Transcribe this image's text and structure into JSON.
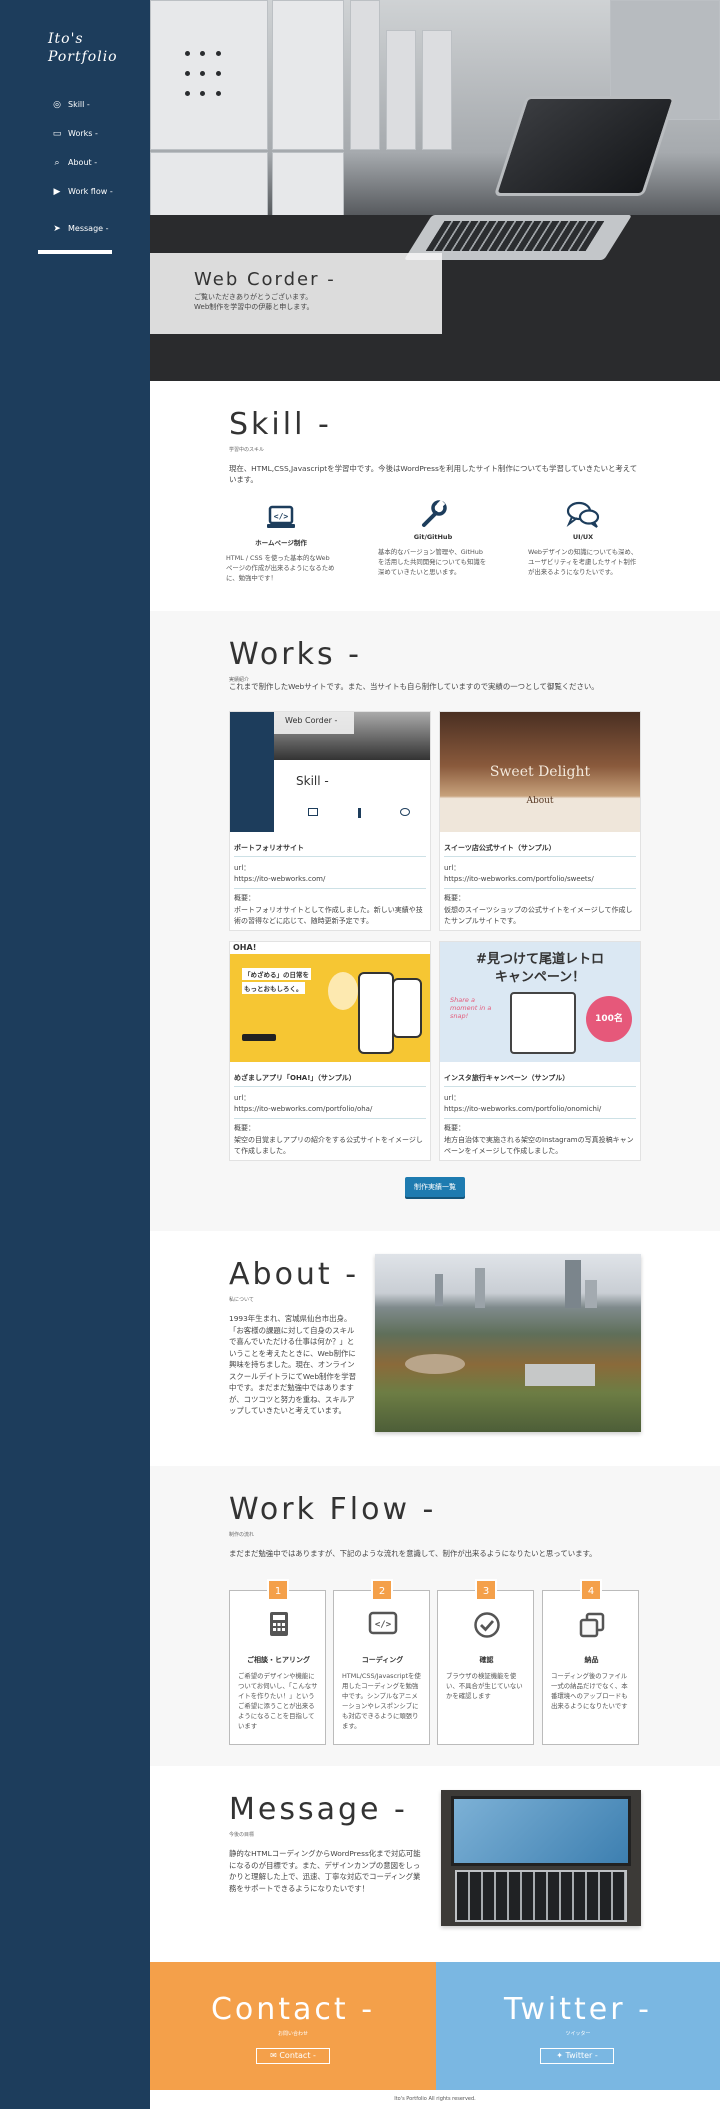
{
  "sidebar": {
    "logo_line1": "Ito's",
    "logo_line2": "Portfolio",
    "nav": [
      {
        "label": "Skill -",
        "icon": "eye-icon"
      },
      {
        "label": "Works -",
        "icon": "laptop-icon"
      },
      {
        "label": "About -",
        "icon": "search-icon"
      },
      {
        "label": "Work flow -",
        "icon": "play-icon"
      },
      {
        "label": "Message -",
        "icon": "send-icon"
      }
    ]
  },
  "hero": {
    "title": "Web Corder -",
    "text_line1": "ご覧いただきありがとうございます。",
    "text_line2": "Web制作を学習中の伊藤と申します。"
  },
  "skill": {
    "title": "Skill -",
    "subtitle": "学習中のスキル",
    "intro": "現在、HTML,CSS,Javascriptを学習中です。今後はWordPressを利用したサイト制作についても学習していきたいと考えています。",
    "items": [
      {
        "name": "ホームページ制作",
        "desc": "HTML / CSS を使った基本的なWebページの作成が出来るようになるために、勉強中です！"
      },
      {
        "name": "Git/GitHub",
        "desc": "基本的なバージョン管理や、GitHubを活用した共同開発についても知識を深めていきたいと思います。"
      },
      {
        "name": "UI/UX",
        "desc": "Webデザインの知識についても深め、ユーザビリティを考慮したサイト制作が出来るようになりたいです。"
      }
    ]
  },
  "works": {
    "title": "Works -",
    "subtitle": "実績紹介",
    "intro": "これまで制作したWebサイトです。また、当サイトも自ら制作していますので実績の一つとして御覧ください。",
    "url_label": "url：",
    "desc_label": "概要：",
    "items": [
      {
        "title": "ポートフォリオサイト",
        "url": "https://ito-webworks.com/",
        "desc": "ポートフォリオサイトとして作成しました。新しい実績や技術の習得などに応じて、随時更新予定です。",
        "thumb_title": "Web Corder -",
        "thumb_skill": "Skill -"
      },
      {
        "title": "スイーツ店公式サイト（サンプル）",
        "url": "https://ito-webworks.com/portfolio/sweets/",
        "desc": "仮想のスイーツショップの公式サイトをイメージして作成したサンプルサイトです。",
        "thumb_title": "Sweet Delight",
        "thumb_about": "About"
      },
      {
        "title": "めざましアプリ「OHA!」（サンプル）",
        "url": "https://ito-webworks.com/portfolio/oha/",
        "desc": "架空の目覚ましアプリの紹介をする公式サイトをイメージして作成しました。",
        "thumb_logo": "OHA!",
        "thumb_headline1": "「めざめる」の日常を",
        "thumb_headline2": "もっとおもしろく。"
      },
      {
        "title": "インスタ旅行キャンペーン（サンプル）",
        "url": "https://ito-webworks.com/portfolio/onomichi/",
        "desc": "地方自治体で実施される架空のInstagramの写真投稿キャンペーンをイメージして作成しました。",
        "thumb_head1": "#見つけて尾道レトロ",
        "thumb_head2": "キャンペーン！",
        "thumb_sub": "Share a moment in a snap!",
        "thumb_badge": "100名"
      }
    ],
    "button_label": "制作実績一覧"
  },
  "about": {
    "title": "About -",
    "subtitle": "私について",
    "text": "1993年生まれ、宮城県仙台市出身。「お客様の課題に対して自身のスキルで喜んでいただける仕事は何か？」ということを考えたときに、Web制作に興味を持ちました。現在、オンラインスクールデイトラにてWeb制作を学習中です。まだまだ勉強中ではありますが、コツコツと努力を重ね、スキルアップしていきたいと考えています。"
  },
  "workflow": {
    "title": "Work Flow -",
    "subtitle": "制作の流れ",
    "intro": "まだまだ勉強中ではありますが、下記のような流れを意識して、制作が出来るようになりたいと思っています。",
    "steps": [
      {
        "num": "1",
        "name": "ご相談・ヒアリング",
        "desc": "ご希望のデザインや機能についてお伺いし、「こんなサイトを作りたい！」というご希望に添うことが出来るようになることを目指しています",
        "icon": "calculator-icon"
      },
      {
        "num": "2",
        "name": "コーディング",
        "desc": "HTML/CSS/Javascriptを使用したコーディングを勉強中です。シンプルなアニメーションやレスポンシブにも対応できるように頑張ります。",
        "icon": "code-icon"
      },
      {
        "num": "3",
        "name": "確認",
        "desc": "ブラウザの検証機能を使い、不具合が生じていないかを確認します",
        "icon": "check-circle-icon"
      },
      {
        "num": "4",
        "name": "納品",
        "desc": "コーディング後のファイル一式の納品だけでなく、本番環境へのアップロードも出来るようになりたいです",
        "icon": "copy-icon"
      }
    ]
  },
  "message": {
    "title": "Message -",
    "subtitle": "今後の目標",
    "text": "静的なHTMLコーディングからWordPress化まで対応可能になるのが目標です。また、デザインカンプの意図をしっかりと理解した上で、迅速、丁寧な対応でコーディング業務をサポートできるようになりたいです！"
  },
  "contact": {
    "title": "Contact -",
    "subtitle": "お問い合わせ",
    "button": "Contact -"
  },
  "twitter": {
    "title": "Twitter -",
    "subtitle": "ツイッター",
    "button": "Twitter -"
  },
  "footer": {
    "text": "Ito's Portfolio All rights reserved."
  },
  "colors": {
    "sidebar": "#1d3d5c",
    "accent_orange": "#f4a04a",
    "accent_blue": "#7ab7e2",
    "button_blue": "#1e7bb0"
  }
}
